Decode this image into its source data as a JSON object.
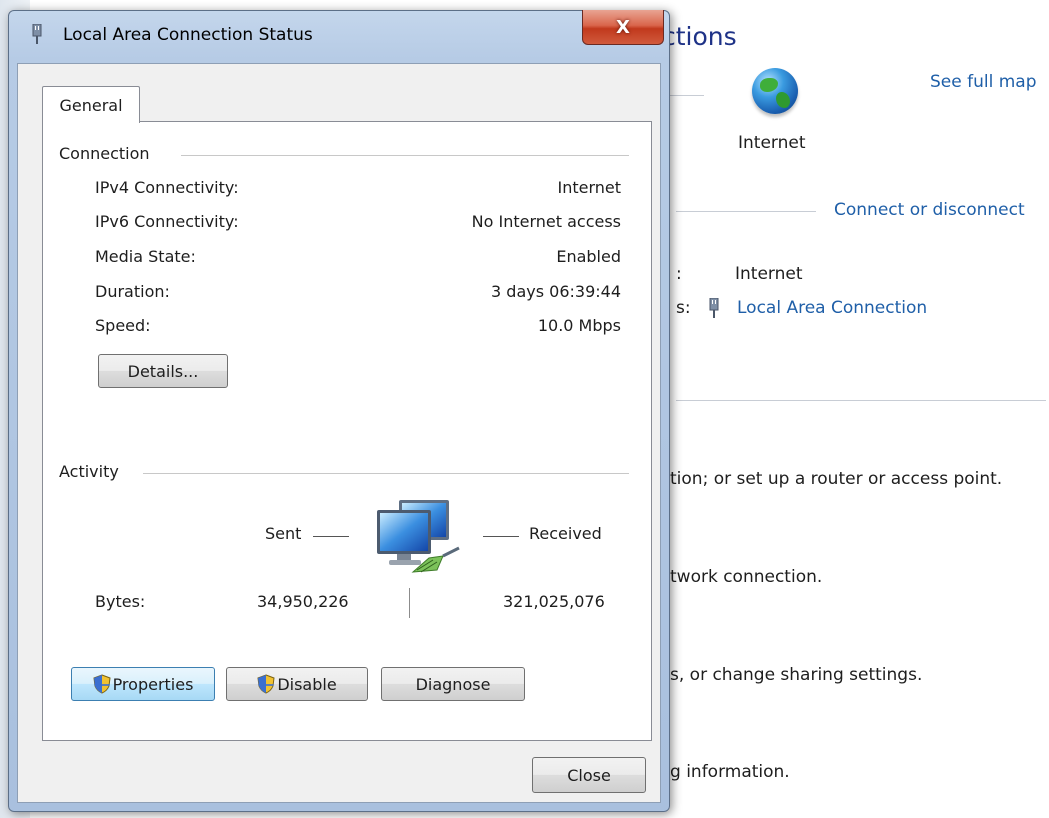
{
  "background": {
    "title_fragment": "ctions",
    "see_full_map": "See full map",
    "internet_label": "Internet",
    "connect_or_disconnect": "Connect or disconnect",
    "access_type_colon": ":",
    "access_type_value": "Internet",
    "connections_fragment": "s:",
    "connection_link": "Local Area Connection",
    "line_router": "tion; or set up a router or access point.",
    "line_network": "twork connection.",
    "line_sharing": "s, or change sharing settings.",
    "line_info": "g information."
  },
  "dialog": {
    "title": "Local Area Connection Status",
    "close_glyph": "X",
    "tab_label": "General",
    "connection": {
      "group_title": "Connection",
      "rows": [
        {
          "label": "IPv4 Connectivity:",
          "value": "Internet"
        },
        {
          "label": "IPv6 Connectivity:",
          "value": "No Internet access"
        },
        {
          "label": "Media State:",
          "value": "Enabled"
        },
        {
          "label": "Duration:",
          "value": "3 days 06:39:44"
        },
        {
          "label": "Speed:",
          "value": "10.0 Mbps"
        }
      ],
      "details_button": "Details..."
    },
    "activity": {
      "group_title": "Activity",
      "sent_label": "Sent",
      "received_label": "Received",
      "bytes_label": "Bytes:",
      "bytes_sent": "34,950,226",
      "bytes_received": "321,025,076"
    },
    "buttons": {
      "properties": "Properties",
      "disable": "Disable",
      "diagnose": "Diagnose",
      "close": "Close"
    }
  },
  "colors": {
    "link": "#1f5fa8",
    "title_bar": "#b6cbe5",
    "close_button": "#c1391d"
  },
  "icons": {
    "window_icon": "network-adapter-icon",
    "globe": "internet-globe-icon",
    "activity": "network-computers-icon",
    "uac": "uac-shield-icon"
  }
}
